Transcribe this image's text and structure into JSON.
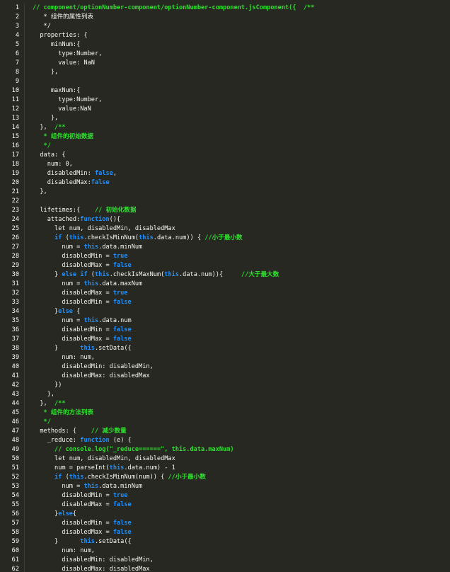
{
  "editor": {
    "theme": {
      "background": "#272822",
      "text": "#f8f8f2",
      "comment": "#2fe02f",
      "keyword": "#1e90ff",
      "gutter_text": "#ffffff"
    },
    "lines": [
      [
        [
          "c",
          "// component/optionNumber-component/optionNumber-component.jsComponent({  /**"
        ]
      ],
      [
        [
          "p",
          "   * 组件的属性列表"
        ]
      ],
      [
        [
          "p",
          "   */"
        ]
      ],
      [
        [
          "p",
          "  properties: {"
        ]
      ],
      [
        [
          "p",
          "     minNum:{"
        ]
      ],
      [
        [
          "p",
          "       type:Number,"
        ]
      ],
      [
        [
          "p",
          "       value: NaN"
        ]
      ],
      [
        [
          "p",
          "     },"
        ]
      ],
      [
        [
          "p",
          ""
        ]
      ],
      [
        [
          "p",
          "     maxNum:{"
        ]
      ],
      [
        [
          "p",
          "       type:Number,"
        ]
      ],
      [
        [
          "p",
          "       value:NaN"
        ]
      ],
      [
        [
          "p",
          "     },"
        ]
      ],
      [
        [
          "p",
          "  },  "
        ],
        [
          "c",
          "/**"
        ]
      ],
      [
        [
          "c",
          "   * 组件的初始数据"
        ]
      ],
      [
        [
          "c",
          "   */"
        ]
      ],
      [
        [
          "p",
          "  data: {"
        ]
      ],
      [
        [
          "p",
          "    num: 0,"
        ]
      ],
      [
        [
          "p",
          "    disabledMin: "
        ],
        [
          "k",
          "false"
        ],
        [
          "p",
          ","
        ]
      ],
      [
        [
          "p",
          "    disabledMax:"
        ],
        [
          "k",
          "false"
        ]
      ],
      [
        [
          "p",
          "  },"
        ]
      ],
      [
        [
          "p",
          ""
        ]
      ],
      [
        [
          "p",
          "  lifetimes:{    "
        ],
        [
          "c",
          "// 初始化数据"
        ]
      ],
      [
        [
          "p",
          "    attached:"
        ],
        [
          "k",
          "function"
        ],
        [
          "p",
          "(){"
        ]
      ],
      [
        [
          "p",
          "      let num, disabledMin, disabledMax"
        ]
      ],
      [
        [
          "p",
          "      "
        ],
        [
          "k",
          "if"
        ],
        [
          "p",
          " ("
        ],
        [
          "k",
          "this"
        ],
        [
          "p",
          ".checkIsMinNum("
        ],
        [
          "k",
          "this"
        ],
        [
          "p",
          ".data.num)) { "
        ],
        [
          "c",
          "//小于最小数"
        ]
      ],
      [
        [
          "p",
          "        num = "
        ],
        [
          "k",
          "this"
        ],
        [
          "p",
          ".data.minNum"
        ]
      ],
      [
        [
          "p",
          "        disabledMin = "
        ],
        [
          "k",
          "true"
        ]
      ],
      [
        [
          "p",
          "        disabledMax = "
        ],
        [
          "k",
          "false"
        ]
      ],
      [
        [
          "p",
          "      } "
        ],
        [
          "k",
          "else if"
        ],
        [
          "p",
          " ("
        ],
        [
          "k",
          "this"
        ],
        [
          "p",
          ".checkIsMaxNum("
        ],
        [
          "k",
          "this"
        ],
        [
          "p",
          ".data.num)){     "
        ],
        [
          "c",
          "//大于最大数"
        ]
      ],
      [
        [
          "p",
          "        num = "
        ],
        [
          "k",
          "this"
        ],
        [
          "p",
          ".data.maxNum"
        ]
      ],
      [
        [
          "p",
          "        disabledMax = "
        ],
        [
          "k",
          "true"
        ]
      ],
      [
        [
          "p",
          "        disabledMin = "
        ],
        [
          "k",
          "false"
        ]
      ],
      [
        [
          "p",
          "      }"
        ],
        [
          "k",
          "else"
        ],
        [
          "p",
          " {"
        ]
      ],
      [
        [
          "p",
          "        num = "
        ],
        [
          "k",
          "this"
        ],
        [
          "p",
          ".data.num"
        ]
      ],
      [
        [
          "p",
          "        disabledMin = "
        ],
        [
          "k",
          "false"
        ]
      ],
      [
        [
          "p",
          "        disabledMax = "
        ],
        [
          "k",
          "false"
        ]
      ],
      [
        [
          "p",
          "      }      "
        ],
        [
          "k",
          "this"
        ],
        [
          "p",
          ".setData({"
        ]
      ],
      [
        [
          "p",
          "        num: num,"
        ]
      ],
      [
        [
          "p",
          "        disabledMin: disabledMin,"
        ]
      ],
      [
        [
          "p",
          "        disabledMax: disabledMax"
        ]
      ],
      [
        [
          "p",
          "      })"
        ]
      ],
      [
        [
          "p",
          "    },"
        ]
      ],
      [
        [
          "p",
          "  },  "
        ],
        [
          "c",
          "/**"
        ]
      ],
      [
        [
          "c",
          "   * 组件的方法列表"
        ]
      ],
      [
        [
          "c",
          "   */"
        ]
      ],
      [
        [
          "p",
          "  methods: {    "
        ],
        [
          "c",
          "// 减少数量"
        ]
      ],
      [
        [
          "p",
          "    _reduce: "
        ],
        [
          "k",
          "function"
        ],
        [
          "p",
          " (e) {"
        ]
      ],
      [
        [
          "c",
          "      // console.log(\"_reduce======\", this.data.maxNum)"
        ]
      ],
      [
        [
          "p",
          "      let num, disabledMin, disabledMax"
        ]
      ],
      [
        [
          "p",
          "      num = parseInt("
        ],
        [
          "k",
          "this"
        ],
        [
          "p",
          ".data.num) - 1"
        ]
      ],
      [
        [
          "p",
          "      "
        ],
        [
          "k",
          "if"
        ],
        [
          "p",
          " ("
        ],
        [
          "k",
          "this"
        ],
        [
          "p",
          ".checkIsMinNum(num)) { "
        ],
        [
          "c",
          "//小于最小数"
        ]
      ],
      [
        [
          "p",
          "        num = "
        ],
        [
          "k",
          "this"
        ],
        [
          "p",
          ".data.minNum"
        ]
      ],
      [
        [
          "p",
          "        disabledMin = "
        ],
        [
          "k",
          "true"
        ]
      ],
      [
        [
          "p",
          "        disabledMax = "
        ],
        [
          "k",
          "false"
        ]
      ],
      [
        [
          "p",
          "      }"
        ],
        [
          "k",
          "else"
        ],
        [
          "p",
          "{"
        ]
      ],
      [
        [
          "p",
          "        disabledMin = "
        ],
        [
          "k",
          "false"
        ]
      ],
      [
        [
          "p",
          "        disabledMax = "
        ],
        [
          "k",
          "false"
        ]
      ],
      [
        [
          "p",
          "      }      "
        ],
        [
          "k",
          "this"
        ],
        [
          "p",
          ".setData({"
        ]
      ],
      [
        [
          "p",
          "        num: num,"
        ]
      ],
      [
        [
          "p",
          "        disabledMin: disabledMin,"
        ]
      ],
      [
        [
          "p",
          "        disabledMax: disabledMax"
        ]
      ]
    ]
  }
}
